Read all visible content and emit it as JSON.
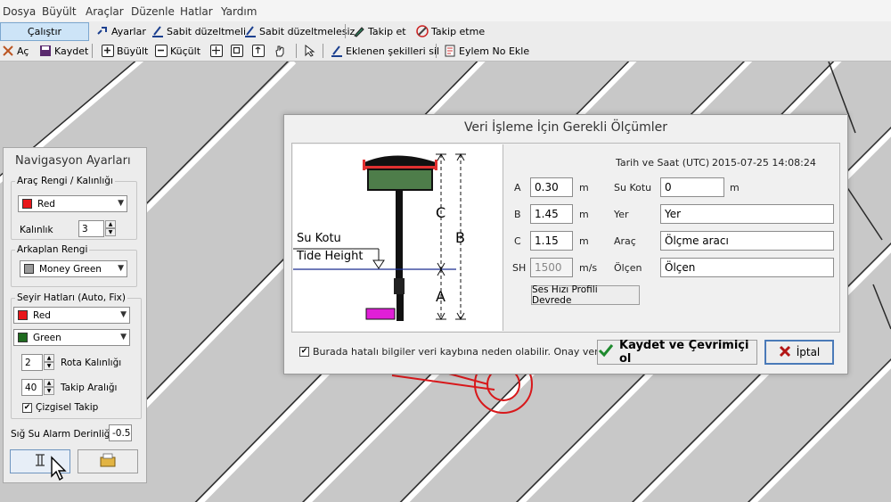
{
  "menubar": {
    "items": [
      "Dosya",
      "Büyült",
      "Araçlar",
      "Düzenle",
      "Hatlar",
      "Yardım"
    ]
  },
  "toolbar1": {
    "run": "Çalıştır",
    "settings": "Ayarlar",
    "fixed_correction": "Sabit düzeltmeli",
    "no_fixed_correction": "Sabit düzeltmelesiz",
    "follow": "Takip et",
    "no_follow": "Takip etme"
  },
  "toolbar2": {
    "open": "Aç",
    "save": "Kaydet",
    "zoom_in": "Büyült",
    "zoom_out": "Küçült",
    "delete_added": "Eklenen şekilleri sil",
    "add_event": "Eylem No Ekle"
  },
  "nav_panel": {
    "title": "Navigasyon Ayarları",
    "vehicle_group": "Araç Rengi / Kalınlığı",
    "vehicle_color": "Red",
    "thickness_label": "Kalınlık",
    "thickness_value": "3",
    "background_group": "Arkaplan Rengi",
    "background_color": "Money Green",
    "lines_group": "Seyir Hatları (Auto, Fix)",
    "line_color_1": "Red",
    "line_color_2": "Green",
    "route_thickness_value": "2",
    "route_thickness_label": "Rota Kalınlığı",
    "follow_interval_value": "40",
    "follow_interval_label": "Takip Aralığı",
    "line_follow_label": "Çizgisel Takip",
    "line_follow_checked": true,
    "shallow_label": "Sığ Su Alarm Derinliği",
    "shallow_value": "-0.5",
    "colors": {
      "red": "#e8171b",
      "green": "#1f6b1f",
      "money_green": "#c0dcc0"
    }
  },
  "dialog": {
    "title": "Veri İşleme İçin Gerekli Ölçümler",
    "datetime_label": "Tarih ve Saat (UTC)",
    "datetime_value": "2015-07-25 14:08:24",
    "diagram": {
      "water_level": "Su Kotu",
      "tide_height": "Tide Height",
      "label_a": "A",
      "label_b": "B",
      "label_c": "C"
    },
    "fields": {
      "a_label": "A",
      "a_value": "0.30",
      "a_unit": "m",
      "b_label": "B",
      "b_value": "1.45",
      "b_unit": "m",
      "c_label": "C",
      "c_value": "1.15",
      "c_unit": "m",
      "sh_label": "SH",
      "sh_value": "1500",
      "sh_unit": "m/s",
      "water_label": "Su Kotu",
      "water_value": "0",
      "water_unit": "m",
      "place_label": "Yer",
      "place_value": "Yer",
      "vehicle_label": "Araç",
      "vehicle_value": "Ölçme aracı",
      "surveyor_label": "Ölçen",
      "surveyor_value": "Ölçen"
    },
    "sound_profile_button": "Ses Hızı Profili Devrede",
    "confirm_label": "Burada hatalı bilgiler veri kaybına neden olabilir. Onay veriniz.",
    "confirm_checked": true,
    "save_button": "Kaydet ve Çevrimiçi ol",
    "cancel_button": "İptal"
  }
}
